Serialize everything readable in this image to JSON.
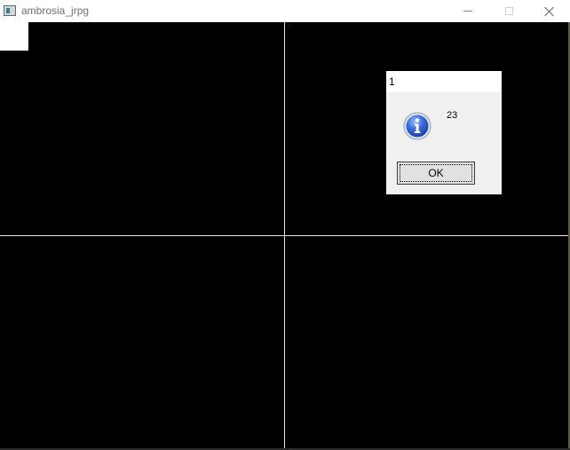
{
  "window": {
    "title": "ambrosia_jrpg",
    "icon": "app-window-icon",
    "controls": [
      "minimize-icon",
      "maximize-icon",
      "close-icon"
    ]
  },
  "message_box": {
    "title": "1",
    "message": "23",
    "icon": "information-icon",
    "ok_label": "OK"
  },
  "colors": {
    "client_background": "#000000",
    "divider": "#e6e6e6",
    "dialog_background": "#f0f0f0",
    "info_icon_blue": "#2a55c8"
  }
}
